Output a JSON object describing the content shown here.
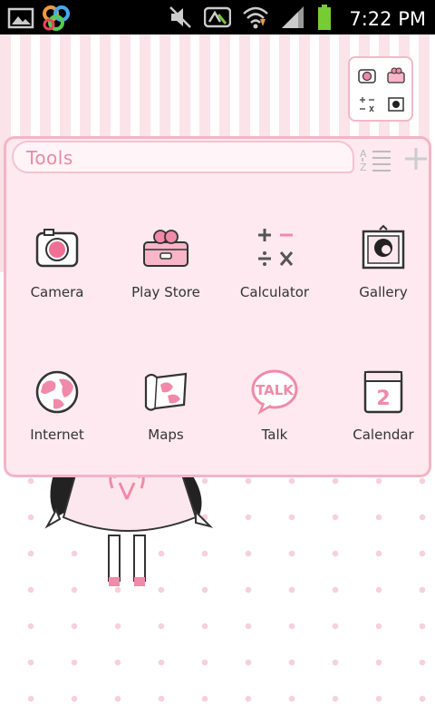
{
  "status_bar": {
    "time": "7:22 PM",
    "icons": [
      "gallery-notification-icon",
      "go-launcher-icon",
      "mute-icon",
      "network-icon",
      "wifi-icon",
      "signal-icon",
      "battery-icon"
    ]
  },
  "folder": {
    "title": "Tools",
    "apps": [
      {
        "label": "Camera",
        "icon": "camera-icon"
      },
      {
        "label": "Play Store",
        "icon": "play-store-icon"
      },
      {
        "label": "Calculator",
        "icon": "calculator-icon"
      },
      {
        "label": "Gallery",
        "icon": "gallery-icon"
      },
      {
        "label": "Internet",
        "icon": "globe-icon"
      },
      {
        "label": "Maps",
        "icon": "map-icon"
      },
      {
        "label": "Talk",
        "icon": "talk-icon"
      },
      {
        "label": "Calendar",
        "icon": "calendar-icon"
      }
    ],
    "calendar_day": "2",
    "talk_text": "TALK"
  },
  "colors": {
    "accent_pink": "#f08aa8",
    "panel_bg": "#fde9ef",
    "panel_border": "#f4b4c6",
    "status_bar_bg": "#000000"
  }
}
